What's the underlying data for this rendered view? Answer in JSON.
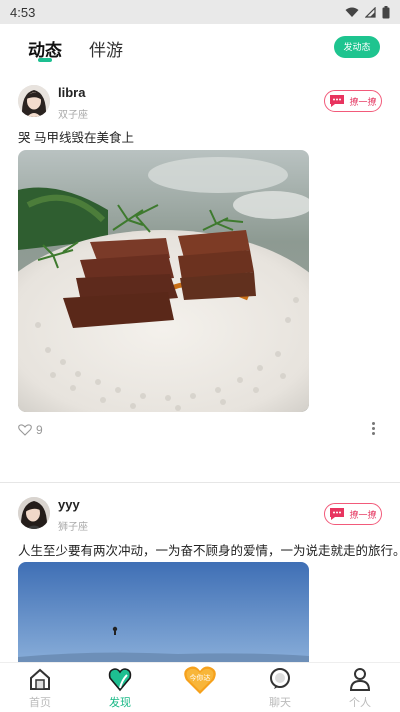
{
  "status": {
    "time": "4:53"
  },
  "header": {
    "tabs": [
      {
        "label": "动态",
        "active": true
      },
      {
        "label": "伴游",
        "active": false
      }
    ],
    "post_button": "发动态"
  },
  "feed": {
    "posts": [
      {
        "username": "libra",
        "zodiac": "双子座",
        "chat_button": "撩一撩",
        "text": "哭 马甲线毁在美食上",
        "likes": "9"
      },
      {
        "username": "yyy",
        "zodiac": "狮子座",
        "chat_button": "撩一撩",
        "text": "人生至少要有两次冲动，一为奋不顾身的爱情，一为说走就走的旅行。"
      }
    ]
  },
  "bottom_nav": {
    "items": [
      {
        "label": "首页",
        "icon": "home-icon"
      },
      {
        "label": "发现",
        "icon": "discover-icon",
        "active": true
      },
      {
        "label": "",
        "icon": "heart-center-icon",
        "badge": "今你达"
      },
      {
        "label": "聊天",
        "icon": "chat-icon"
      },
      {
        "label": "个人",
        "icon": "profile-icon"
      }
    ]
  },
  "colors": {
    "accent": "#1ec48f",
    "chat_pink": "#e53a63"
  }
}
